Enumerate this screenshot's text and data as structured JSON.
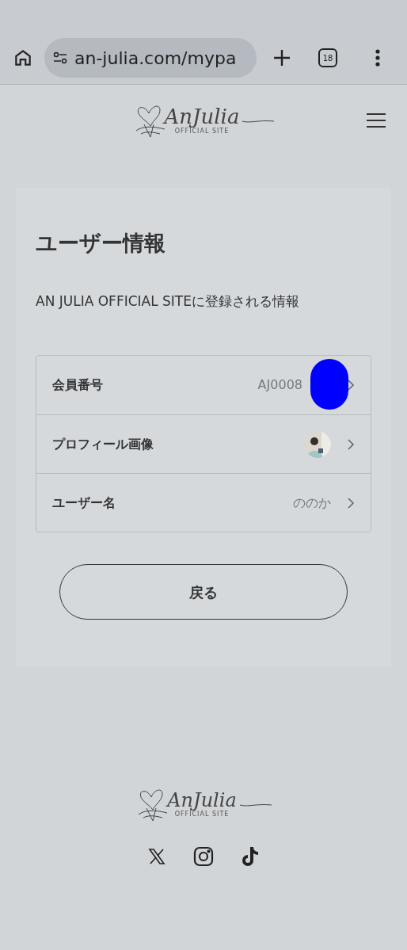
{
  "browser": {
    "url": "an-julia.com/mypa",
    "tab_count": "18"
  },
  "header": {
    "logo": {
      "wordmark": "AnJulia",
      "tagline": "OFFICIAL SITE"
    }
  },
  "page": {
    "title": "ユーザー情報",
    "description": "AN JULIA OFFICIAL SITEに登録される情報",
    "rows": [
      {
        "kind": "text",
        "label": "会員番号",
        "value": "AJ0008",
        "redacted": true
      },
      {
        "kind": "avatar",
        "label": "プロフィール画像"
      },
      {
        "kind": "text",
        "label": "ユーザー名",
        "value": "ののか",
        "redacted": false
      }
    ],
    "back_button": "戻る"
  },
  "footer": {
    "logo": {
      "wordmark": "AnJulia",
      "tagline": "OFFICIAL SITE"
    },
    "social": [
      {
        "kind": "x"
      },
      {
        "kind": "instagram"
      },
      {
        "kind": "tiktok"
      }
    ]
  }
}
